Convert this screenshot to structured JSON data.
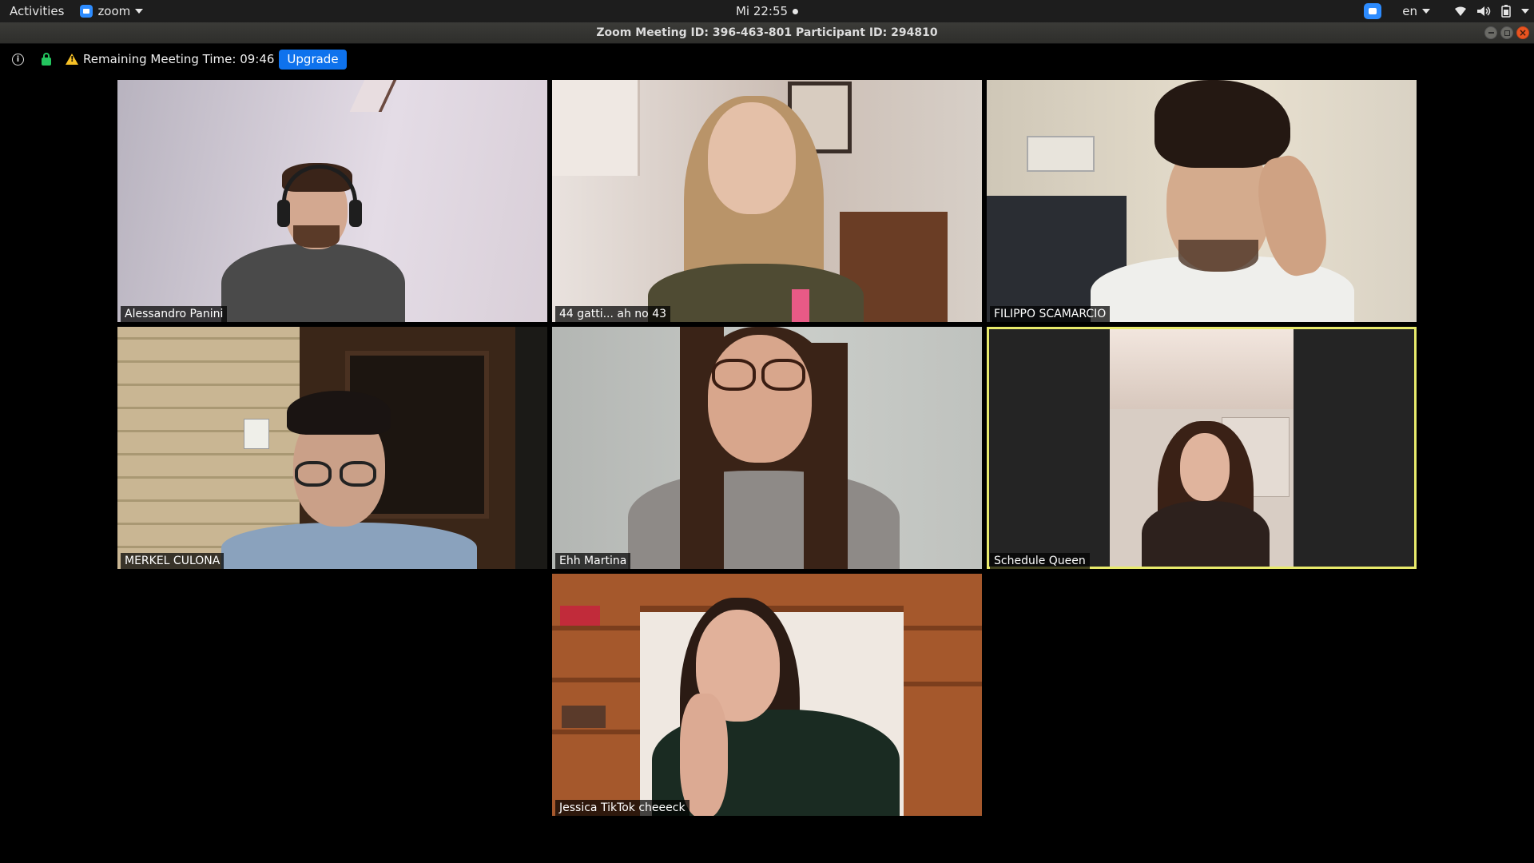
{
  "topbar": {
    "activities": "Activities",
    "app_name": "zoom",
    "clock": "Mi 22:55",
    "language": "en"
  },
  "window": {
    "title": "Zoom Meeting ID: 396-463-801 Participant ID: 294810"
  },
  "infobar": {
    "remaining_time": "Remaining Meeting Time: 09:46",
    "upgrade_label": "Upgrade"
  },
  "participants": [
    {
      "name": "Alessandro Panini"
    },
    {
      "name": "44 gatti... ah no 43"
    },
    {
      "name": "FILIPPO SCAMARCIO"
    },
    {
      "name": "MERKEL CULONA"
    },
    {
      "name": "Ehh Martina"
    },
    {
      "name": "Schedule Queen",
      "active_speaker": true
    },
    {
      "name": "Jessica TikTok cheeeck"
    }
  ],
  "colors": {
    "zoom_blue": "#2d8cff",
    "upgrade_blue": "#0e72ed",
    "active_speaker_border": "#e8ea6b",
    "secure_green": "#23c55e",
    "warning_yellow": "#f6c026"
  }
}
